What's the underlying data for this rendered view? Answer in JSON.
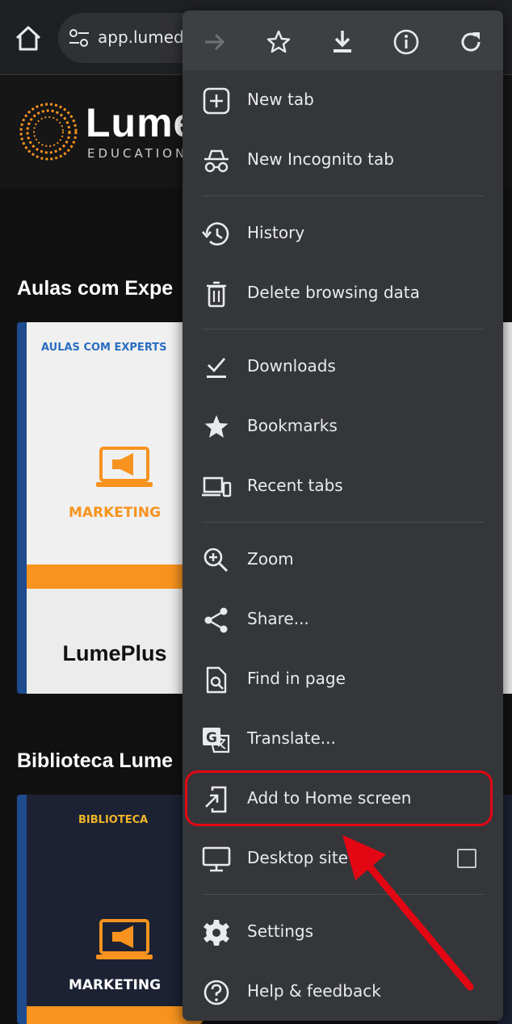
{
  "browser": {
    "url": "app.lumedu"
  },
  "page": {
    "logo_name": "Lume",
    "logo_subtitle": "EDUCATION",
    "section1_title": "Aulas com Expe",
    "section2_title": "Biblioteca Lume",
    "card1": {
      "badge": "AULAS COM EXPERTS",
      "label": "MARKETING",
      "brand": "LumePlus"
    },
    "card2": {
      "badge": "BIBLIOTECA",
      "label": "MARKETING"
    }
  },
  "menu": {
    "top_icons": [
      "forward-icon",
      "star-icon",
      "download-icon",
      "info-icon",
      "refresh-icon"
    ],
    "items": [
      {
        "label": "New tab",
        "icon": "add-box-icon"
      },
      {
        "label": "New Incognito tab",
        "icon": "incognito-icon"
      },
      {
        "label": "History",
        "icon": "history-icon"
      },
      {
        "label": "Delete browsing data",
        "icon": "trash-icon"
      },
      {
        "label": "Downloads",
        "icon": "downloads-check-icon"
      },
      {
        "label": "Bookmarks",
        "icon": "star-filled-icon"
      },
      {
        "label": "Recent tabs",
        "icon": "devices-icon"
      },
      {
        "label": "Zoom",
        "icon": "zoom-icon"
      },
      {
        "label": "Share...",
        "icon": "share-icon"
      },
      {
        "label": "Find in page",
        "icon": "find-in-page-icon"
      },
      {
        "label": "Translate...",
        "icon": "translate-icon"
      },
      {
        "label": "Add to Home screen",
        "icon": "add-to-home-icon"
      },
      {
        "label": "Desktop site",
        "icon": "desktop-icon",
        "checked": false
      },
      {
        "label": "Settings",
        "icon": "gear-icon"
      },
      {
        "label": "Help & feedback",
        "icon": "help-icon"
      }
    ]
  },
  "annotation": {
    "highlight_color": "#e30613"
  },
  "colors": {
    "menu_bg": "#35363a",
    "accent_orange": "#f7931e",
    "brand_blue": "#1f4b8f"
  }
}
